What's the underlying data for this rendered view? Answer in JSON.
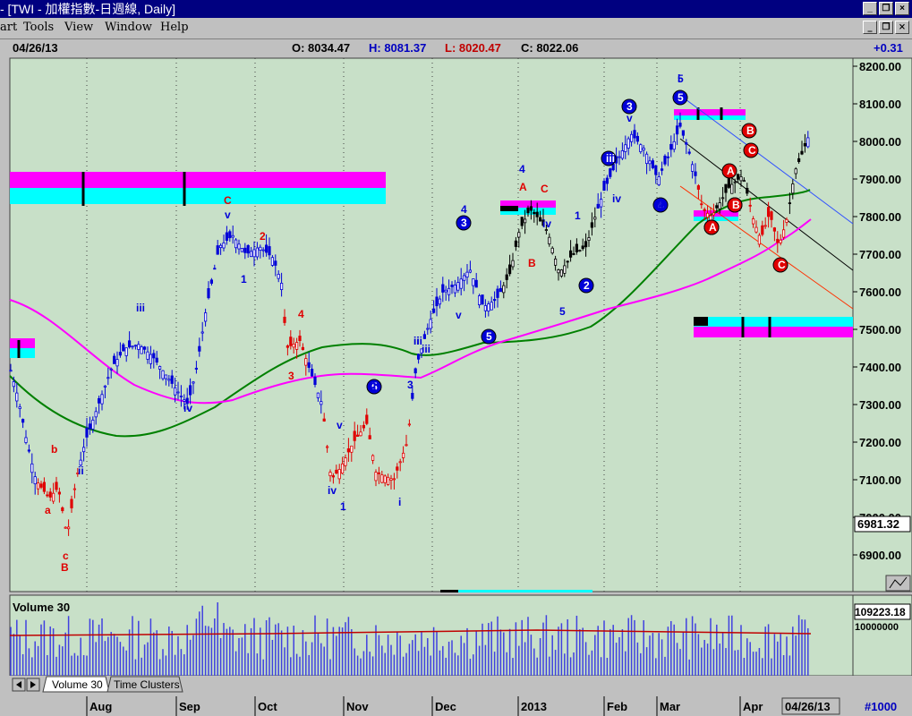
{
  "window": {
    "title": "- [TWI - 加權指數-日週線, Daily]",
    "min_glyph": "_",
    "restore_glyph": "❐",
    "close_glyph": "×"
  },
  "menu": [
    "art",
    "Tools",
    "View",
    "Window",
    "Help"
  ],
  "info": {
    "date": "04/26/13",
    "open": "O: 8034.47",
    "high": "H: 8081.37",
    "low": "L: 8020.47",
    "close": "C: 8022.06",
    "change": "+0.31"
  },
  "price_axis": {
    "ticks": [
      "8200.00",
      "8100.00",
      "8000.00",
      "7900.00",
      "7800.00",
      "7700.00",
      "7600.00",
      "7500.00",
      "7400.00",
      "7300.00",
      "7200.00",
      "7100.00",
      "7000.00",
      "6900.00"
    ],
    "current_label": "6981.32"
  },
  "volume": {
    "title": "Volume 30",
    "value_label": "109223.18",
    "extra_label": "10000000"
  },
  "tabs": [
    "Volume 30",
    "Time Clusters"
  ],
  "time_axis": {
    "labels": [
      "Aug",
      "Sep",
      "Oct",
      "Nov",
      "Dec",
      "2013",
      "Feb",
      "Mar",
      "Apr"
    ],
    "current_date": "04/26/13",
    "bar_count": "#1000"
  },
  "wave_labels": [
    "a",
    "b",
    "c",
    "B",
    "ii",
    "iii",
    "iv",
    "v",
    "C",
    "1",
    "2",
    "3",
    "4",
    "5",
    "i",
    "ii",
    "iii",
    "iv",
    "v",
    "1",
    "2",
    "3",
    "4",
    "5",
    "i",
    "iii",
    "iv",
    "v",
    "3",
    "4",
    "5",
    "A",
    "B",
    "C",
    "1",
    "2",
    "3",
    "4",
    "5",
    "iii",
    "iv",
    "v",
    "A",
    "B",
    "C",
    "4",
    "5",
    "A",
    "B",
    "C",
    "A",
    "B",
    "C"
  ],
  "colors": {
    "chart_bg": "#c8e0c8",
    "blue": "#0000d8",
    "red": "#e00000",
    "ma_green": "#008000",
    "ma_magenta": "#ff00ff",
    "cyan": "#00ffff",
    "title_bar": "#000080"
  },
  "chart_data": {
    "type": "candlestick",
    "ylim": [
      6800,
      8200
    ],
    "y_ticks": [
      8200,
      8100,
      8000,
      7900,
      7800,
      7700,
      7600,
      7500,
      7400,
      7300,
      7200,
      7100,
      7000,
      6900
    ],
    "x_labels": [
      "Aug",
      "Sep",
      "Oct",
      "Nov",
      "Dec",
      "2013",
      "Feb",
      "Mar",
      "Apr"
    ],
    "last_bar": {
      "date": "04/26/13",
      "open": 8034.47,
      "high": 8081.37,
      "low": 8020.47,
      "close": 8022.06
    },
    "current_price_label": 6981.32,
    "moving_averages": [
      "green",
      "magenta"
    ],
    "volume_indicator": "Volume 30"
  }
}
